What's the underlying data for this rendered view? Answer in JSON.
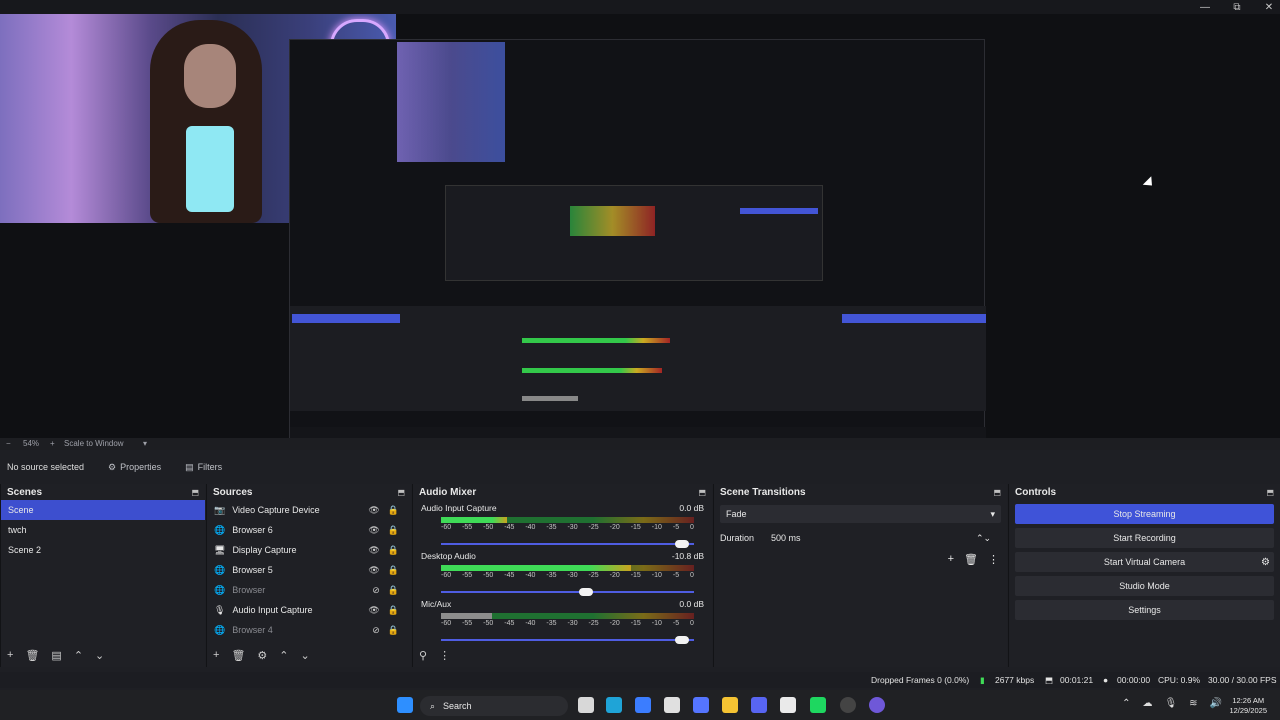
{
  "window": {
    "controls": [
      "—",
      "⧉",
      "✕"
    ]
  },
  "preview_footer": {
    "zoom": "54%",
    "scale_mode": "Scale to Window"
  },
  "source_bar": {
    "status": "No source selected",
    "properties": "Properties",
    "filters": "Filters"
  },
  "scenes": {
    "title": "Scenes",
    "items": [
      "Scene",
      "twch",
      "Scene 2"
    ],
    "selected": 0
  },
  "sources": {
    "title": "Sources",
    "items": [
      {
        "name": "Video Capture Device",
        "icon": "camera-icon"
      },
      {
        "name": "Browser 6",
        "icon": "globe-icon"
      },
      {
        "name": "Display Capture",
        "icon": "monitor-icon"
      },
      {
        "name": "Browser 5",
        "icon": "globe-icon"
      },
      {
        "name": "Browser",
        "icon": "globe-icon"
      },
      {
        "name": "Audio Input Capture",
        "icon": "mic-icon"
      },
      {
        "name": "Browser 4",
        "icon": "globe-icon"
      }
    ]
  },
  "audio_mixer": {
    "title": "Audio Mixer",
    "scale": [
      "-60",
      "-55",
      "-50",
      "-45",
      "-40",
      "-35",
      "-30",
      "-25",
      "-20",
      "-15",
      "-10",
      "-5",
      "0"
    ],
    "channels": [
      {
        "name": "Audio Input Capture",
        "db": "0.0 dB",
        "level": 0.26,
        "volume": 0.98
      },
      {
        "name": "Desktop Audio",
        "db": "-10.8 dB",
        "level": 0.75,
        "volume": 0.6
      },
      {
        "name": "Mic/Aux",
        "db": "0.0 dB",
        "level": 0.2,
        "volume": 0.98
      }
    ]
  },
  "transitions": {
    "title": "Scene Transitions",
    "selected": "Fade",
    "duration_label": "Duration",
    "duration_value": "500 ms"
  },
  "controls": {
    "title": "Controls",
    "buttons": [
      "Stop Streaming",
      "Start Recording",
      "Start Virtual Camera",
      "Studio Mode",
      "Settings"
    ]
  },
  "status": {
    "dropped_frames": "Dropped Frames 0 (0.0%)",
    "bitrate": "2677 kbps",
    "stream_time": "00:01:21",
    "record_time": "00:00:00",
    "cpu": "CPU: 0.9%",
    "fps": "30.00 / 30.00 FPS"
  },
  "taskbar": {
    "search": "Search",
    "time": "12:26 AM",
    "date": "12/29/2025"
  },
  "colors": {
    "accent": "#3f53d8",
    "panel": "#1f2025",
    "meter_green": "#3fdb57",
    "meter_yellow": "#caa21f",
    "meter_red": "#672020"
  }
}
